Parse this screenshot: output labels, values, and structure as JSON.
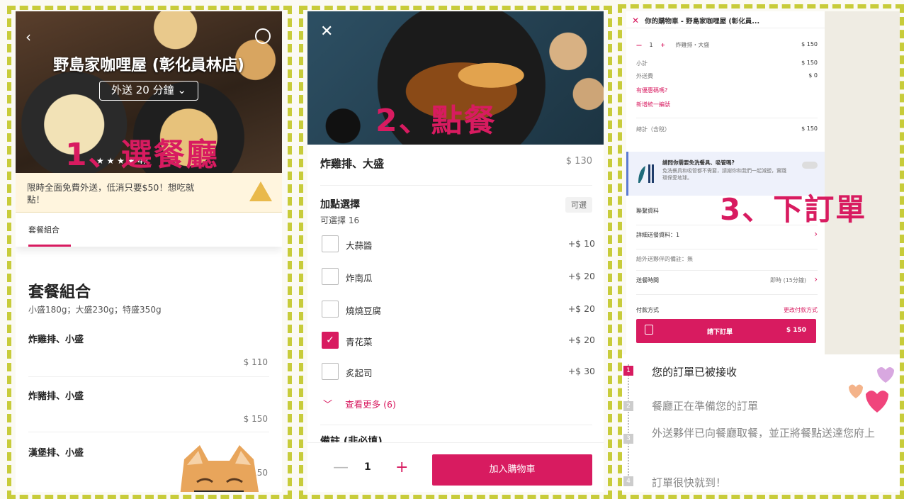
{
  "panel1": {
    "restaurant": "野島家咖哩屋 (彰化員林店)",
    "delivery_pill": "外送 20 分鐘",
    "rating": "★ ★ ★ ★ 4.(",
    "step_label": "1、選餐廳",
    "promo": "限時全面免費外送，低消只要$50！想吃就點！",
    "tab": "套餐組合",
    "section_title": "套餐組合",
    "section_sub": "小盛180g；大盛230g；特盛350g",
    "items": [
      {
        "name": "炸雞排、小盛",
        "price": "$ 110"
      },
      {
        "name": "炸豬排、小盛",
        "price": "$ 150"
      },
      {
        "name": "漢堡排、小盛",
        "price": "$ 150"
      }
    ]
  },
  "panel2": {
    "step_label": "2、點餐",
    "item_name": "炸雞排、大盛",
    "item_price": "$ 130",
    "addon_title": "加點選擇",
    "addon_sub": "可選擇 16",
    "addon_badge": "可選",
    "options": [
      {
        "label": "大蒜醬",
        "price": "+$ 10",
        "checked": false
      },
      {
        "label": "炸南瓜",
        "price": "+$ 20",
        "checked": false
      },
      {
        "label": "燒燒豆腐",
        "price": "+$ 20",
        "checked": false
      },
      {
        "label": "青花菜",
        "price": "+$ 20",
        "checked": true
      },
      {
        "label": "炙起司",
        "price": "+$ 30",
        "checked": false
      }
    ],
    "see_more": "查看更多 (6)",
    "notes_label": "備註 (非必填)",
    "qty": "1",
    "minus": "—",
    "plus": "+",
    "add_to_cart": "加入購物車"
  },
  "panel3": {
    "header": "你的購物車 - 野島家咖哩屋 (彰化員...",
    "cart_line": "炸雞排・大盛",
    "cart_qty": "1",
    "cart_price": "$ 150",
    "subtotal_label": "小計",
    "subtotal": "$ 150",
    "delivery_label": "外送費",
    "delivery": "$ 0",
    "coupon": "有優惠碼嗎?",
    "invoice": "新增統一編號",
    "total_label": "總計（含稅）",
    "total": "$ 150",
    "note_title": "請問你需要免洗餐具、吸管嗎?",
    "note_body": "免洗餐具和吸管都不需要，請謝你和我們一起減塑，實踐環保愛地球。",
    "contact": "聯繫資料",
    "address": "詳細送餐資料：1",
    "rider_note": "給外送夥伴的備註：無",
    "time_label": "送餐時間",
    "time_value": "即時 (15分鐘)",
    "pay_label": "付款方式",
    "pay_change": "更改付款方式",
    "place_order": "請下訂單",
    "order_total": "$ 150",
    "step_label": "3、下訂單"
  },
  "status": {
    "steps": [
      {
        "num": "1",
        "text": "您的訂單已被接收"
      },
      {
        "num": "2",
        "text": "餐廳正在準備您的訂單"
      },
      {
        "num": "3",
        "text": "外送夥伴已向餐廳取餐，並正將餐點送達您府上"
      },
      {
        "num": "4",
        "text": "訂單很快就到！"
      }
    ]
  },
  "colors": {
    "accent": "#d81b60",
    "frame": "#c8cc3a"
  }
}
